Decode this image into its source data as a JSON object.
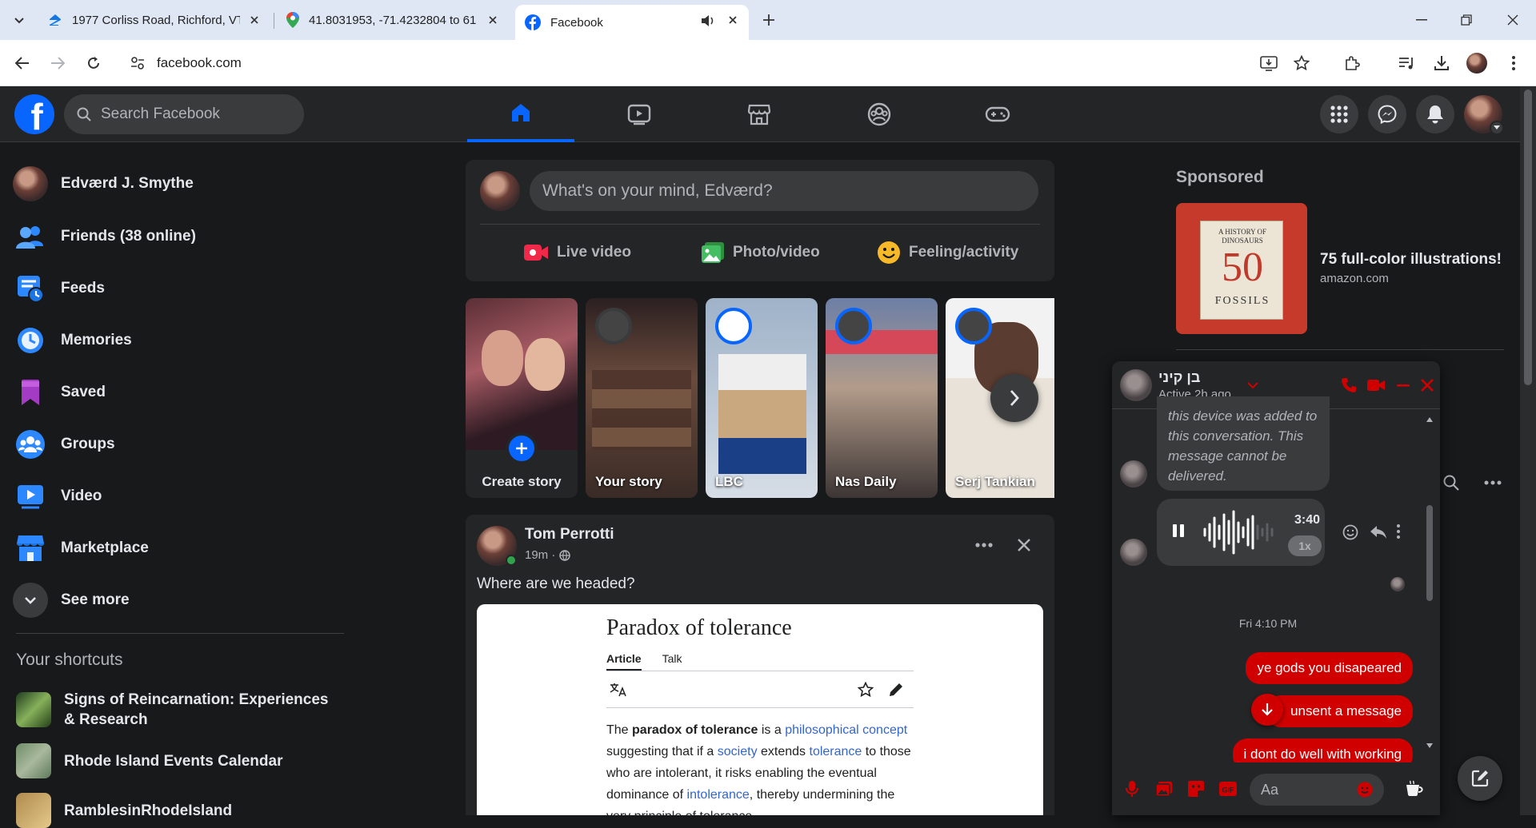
{
  "browser": {
    "tabs": [
      {
        "title": "1977 Corliss Road, Richford, VT",
        "icon": "zillow-icon",
        "active": false
      },
      {
        "title": "41.8031953, -71.4232804 to 61.",
        "icon": "maps-icon",
        "active": false
      },
      {
        "title": "Facebook",
        "icon": "facebook-icon",
        "active": true,
        "audio": true
      }
    ],
    "url": "facebook.com"
  },
  "header": {
    "search_placeholder": "Search Facebook",
    "nav": [
      "home-icon",
      "video-icon",
      "marketplace-icon",
      "groups-icon",
      "gaming-icon"
    ]
  },
  "sidebar": {
    "profile_name": "Edværd J. Smythe",
    "items": [
      {
        "label": "Friends (38 online)",
        "icon": "friends-icon"
      },
      {
        "label": "Feeds",
        "icon": "feeds-icon"
      },
      {
        "label": "Memories",
        "icon": "memories-icon"
      },
      {
        "label": "Saved",
        "icon": "saved-icon"
      },
      {
        "label": "Groups",
        "icon": "groups-icon"
      },
      {
        "label": "Video",
        "icon": "video-icon"
      },
      {
        "label": "Marketplace",
        "icon": "marketplace-icon"
      },
      {
        "label": "See more",
        "icon": "chevron-down-icon"
      }
    ],
    "shortcuts_heading": "Your shortcuts",
    "shortcuts": [
      {
        "label": "Signs of Reincarnation: Experiences & Research"
      },
      {
        "label": "Rhode Island Events Calendar"
      },
      {
        "label": "RamblesinRhodeIsland"
      }
    ]
  },
  "composer": {
    "placeholder": "What's on your mind, Edværd?",
    "actions": [
      "Live video",
      "Photo/video",
      "Feeling/activity"
    ]
  },
  "stories": [
    {
      "name": "Create story"
    },
    {
      "name": "Your story"
    },
    {
      "name": "LBC"
    },
    {
      "name": "Nas Daily"
    },
    {
      "name": "Serj Tankian"
    }
  ],
  "post": {
    "author": "Tom Perrotti",
    "time": "19m ·",
    "text": "Where are we headed?",
    "card": {
      "title": "Paradox of tolerance",
      "tab_article": "Article",
      "tab_talk": "Talk",
      "p_the": "The ",
      "p_bold": "paradox of tolerance",
      "p_is": " is a ",
      "link1": "philosophical concept",
      "p_mid": " suggesting that if a ",
      "link2": "society",
      "p_ext": " extends ",
      "link3": "tolerance",
      "p_rest": " to those who are intolerant, it risks enabling the eventual dominance of ",
      "link4": "intolerance",
      "p_end": ", thereby undermining the very principle of tolerance."
    }
  },
  "sponsored": {
    "heading": "Sponsored",
    "ad_title": "75 full-color illustrations!",
    "ad_site": "amazon.com",
    "ad_image_text": {
      "top": "A HISTORY OF DINOSAURS",
      "num": "50",
      "bottom": "FOSSILS"
    }
  },
  "chat": {
    "name": "בן קיני",
    "status": "Active 2h ago",
    "system_message": "this device was added to this conversation. This message cannot be delivered.",
    "voice_duration": "3:40",
    "voice_speed": "1x",
    "timestamp": "Fri 4:10 PM",
    "messages": [
      "ye gods you disapeared",
      "unsent a message",
      "i dont do well with working"
    ],
    "input_placeholder": "Aa"
  },
  "colors": {
    "fb_blue": "#0866ff",
    "chat_accent": "#d10000",
    "bg": "#18191a",
    "surface": "#242526"
  }
}
